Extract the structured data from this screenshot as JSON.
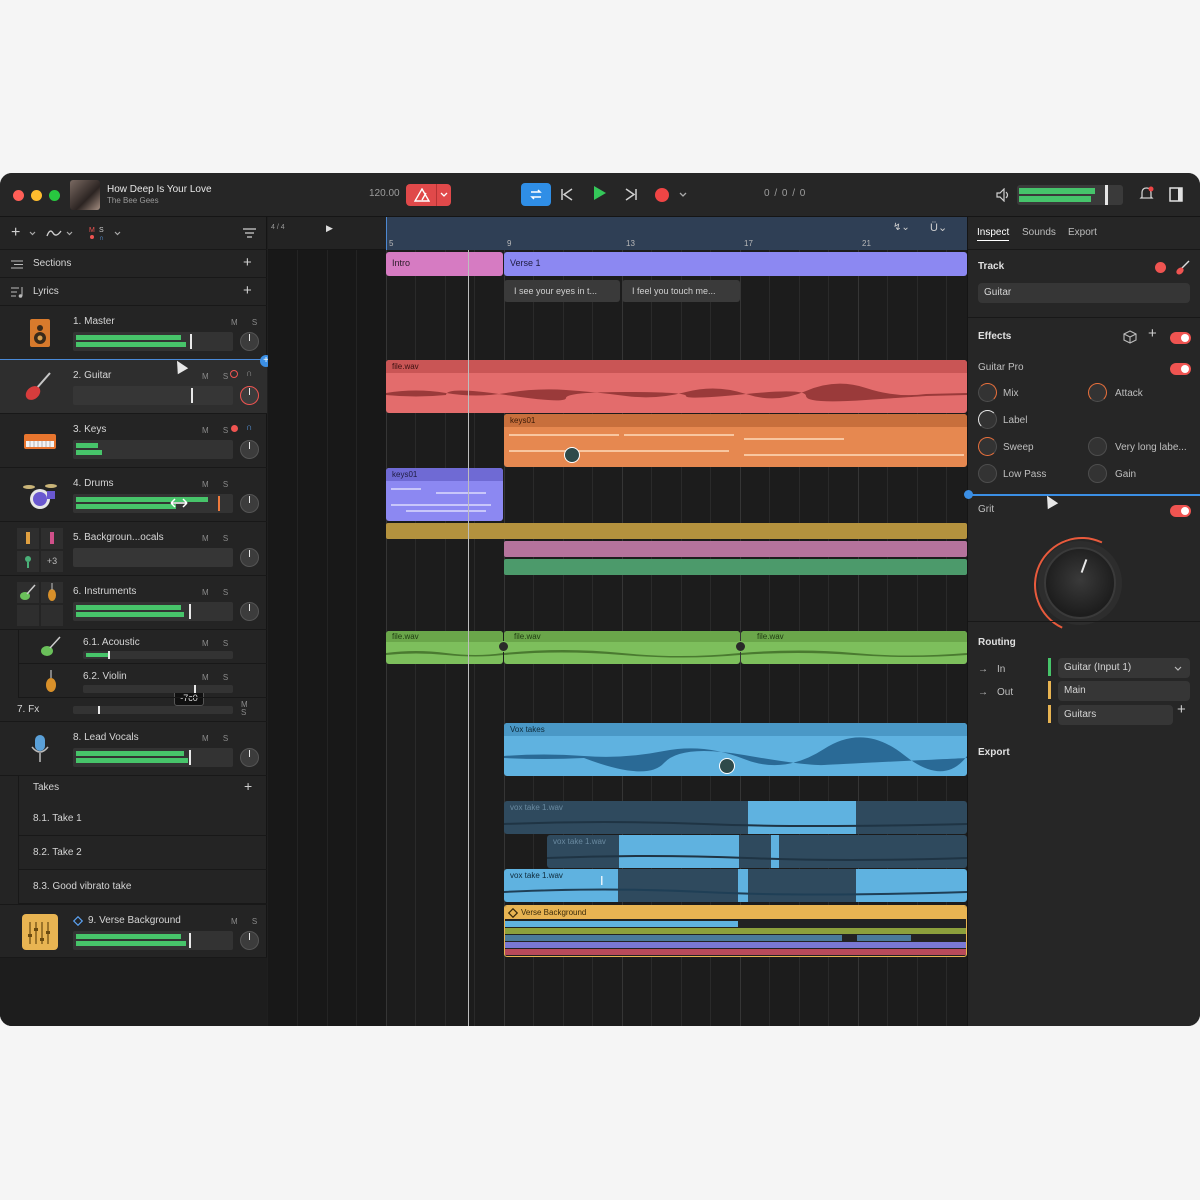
{
  "window": {
    "song_title": "How Deep Is Your Love",
    "artist": "The Bee Gees",
    "bpm": "120.00",
    "counter": "0 / 0 / 0"
  },
  "left": {
    "sections_label": "Sections",
    "lyrics_label": "Lyrics",
    "tracks": [
      {
        "name": "1. Master",
        "msr": "M S"
      },
      {
        "name": "2. Guitar",
        "msr": "M S"
      },
      {
        "name": "3. Keys",
        "msr": "M S"
      },
      {
        "name": "4. Drums",
        "msr": "M S"
      },
      {
        "name": "5. Backgroun...ocals",
        "msr": "M S"
      },
      {
        "name": "6. Instruments",
        "msr": "M S"
      },
      {
        "name": "6.1. Acoustic",
        "msr": "M S"
      },
      {
        "name": "6.2. Violin",
        "msr": "M S"
      },
      {
        "name": "7. Fx",
        "msr": "M S"
      },
      {
        "name": "8. Lead Vocals",
        "msr": "M S"
      },
      {
        "name": "9. Verse Background",
        "msr": "M S"
      }
    ],
    "takes_label": "Takes",
    "takes": [
      "8.1. Take 1",
      "8.2. Take 2",
      "8.3. Good vibrato take"
    ],
    "bg_badge": "+3",
    "tooltip": "-7c0"
  },
  "timeline": {
    "time_sig": "4 / 4",
    "ticks": [
      "5",
      "9",
      "13",
      "17",
      "21"
    ],
    "sections": [
      "Intro",
      "Verse 1"
    ],
    "lyrics": [
      "I see your eyes in t...",
      "I feel you touch me..."
    ],
    "clips": {
      "guitar": "file.wav",
      "keys": "keys01",
      "drums": "keys01",
      "acoustic": [
        "file.wav",
        "file.wav",
        "file.wav"
      ],
      "vocals": "Vox takes",
      "take1": "vox take 1.wav",
      "take2": "vox take 1.wav",
      "take3": "vox take 1.wav",
      "verse_bg": "Verse Background"
    }
  },
  "right": {
    "tabs": [
      "Inspect",
      "Sounds",
      "Export"
    ],
    "track_title": "Track",
    "track_name": "Guitar",
    "effects_title": "Effects",
    "plugin": "Guitar Pro",
    "params": [
      "Mix",
      "Attack",
      "Label",
      "Sweep",
      "Very long labe...",
      "Low Pass",
      "Gain"
    ],
    "grit": "Grit",
    "routing_title": "Routing",
    "in_label": "In",
    "out_label": "Out",
    "in_value": "Guitar (Input 1)",
    "out_value": "Main",
    "send_value": "Guitars",
    "export_title": "Export"
  }
}
